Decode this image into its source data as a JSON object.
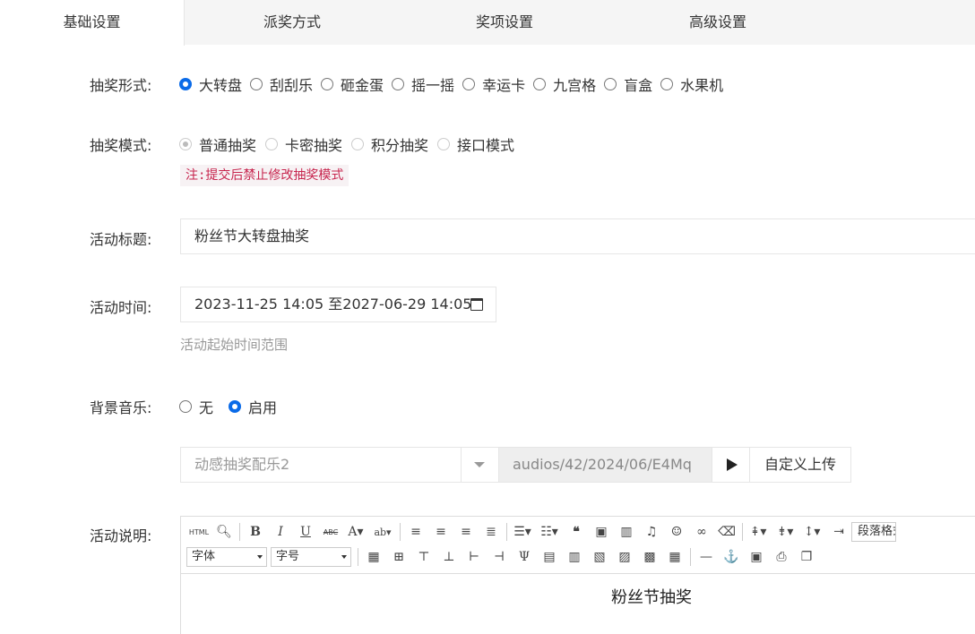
{
  "tabs": [
    {
      "label": "基础设置"
    },
    {
      "label": "派奖方式"
    },
    {
      "label": "奖项设置"
    },
    {
      "label": "高级设置"
    }
  ],
  "draw_form": {
    "label": "抽奖形式:",
    "options": [
      "大转盘",
      "刮刮乐",
      "砸金蛋",
      "摇一摇",
      "幸运卡",
      "九宫格",
      "盲盒",
      "水果机"
    ],
    "selected": "大转盘"
  },
  "draw_mode": {
    "label": "抽奖模式:",
    "options": [
      "普通抽奖",
      "卡密抽奖",
      "积分抽奖",
      "接口模式"
    ],
    "selected": "普通抽奖",
    "note": "注:提交后禁止修改抽奖模式"
  },
  "activity_title": {
    "label": "活动标题:",
    "value": "粉丝节大转盘抽奖"
  },
  "activity_time": {
    "label": "活动时间:",
    "value": "2023-11-25 14:05 至2027-06-29 14:05",
    "icon": "calendar-icon",
    "hint": "活动起始时间范围"
  },
  "bg_music": {
    "label": "背景音乐:",
    "options": [
      "无",
      "启用"
    ],
    "selected": "启用",
    "track": "动感抽奖配乐2",
    "path": "audios/42/2024/06/E4Mq",
    "upload_label": "自定义上传"
  },
  "description": {
    "label": "活动说明:",
    "toolbar": {
      "html_label": "HTML",
      "font_select": "字体",
      "size_select": "字号",
      "paragraph": "段落格式"
    },
    "content": "粉丝节抽奖"
  },
  "colors": {
    "accent": "#0b6be8",
    "note_text": "#c7254e",
    "note_bg": "#f7f2f4",
    "tab_bg": "#f5f5f5"
  }
}
